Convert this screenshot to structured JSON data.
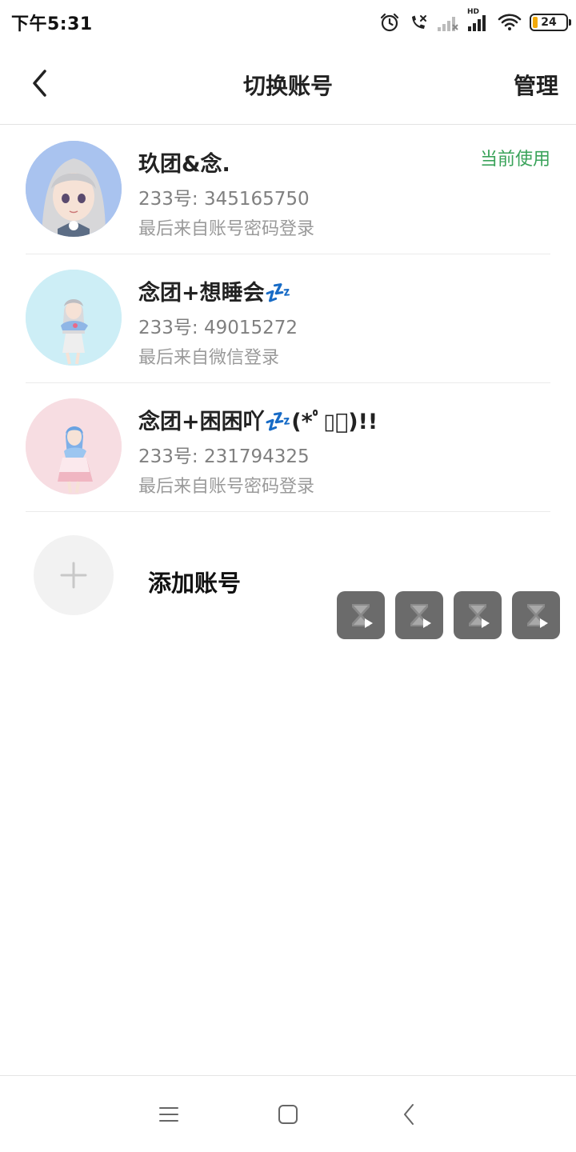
{
  "status_bar": {
    "time": "下午5:31",
    "network_label": "HD",
    "battery_level": "24",
    "icons": [
      "alarm-icon",
      "call-muted-icon",
      "signal-weak-icon",
      "signal-hd-icon",
      "wifi-icon",
      "battery-icon"
    ]
  },
  "header": {
    "title": "切换账号",
    "manage_label": "管理",
    "back_icon": "chevron-left-icon"
  },
  "accounts": [
    {
      "name": "玖团&念.",
      "id_text": "233号: 345165750",
      "login_text": "最后来自账号密码登录",
      "badge": "当前使用",
      "avatar_bg": "#a9c3ef"
    },
    {
      "name": "念团+想睡会💤",
      "id_text": "233号: 49015272",
      "login_text": "最后来自微信登录",
      "badge": "",
      "avatar_bg": "#cdeef6"
    },
    {
      "name": "念团+困困吖💤(*ﾟ▯ﾟ)!!",
      "id_text": "233号: 231794325",
      "login_text": "最后来自账号密码登录",
      "badge": "",
      "avatar_bg": "#f7dde2"
    }
  ],
  "add_account": {
    "label": "添加账号",
    "icon": "plus-icon"
  },
  "tool_buttons": [
    "hourglass-play-icon",
    "hourglass-play-icon",
    "hourglass-play-icon",
    "hourglass-play-icon"
  ],
  "colors": {
    "current_badge": "#3aa35a",
    "tool_button_bg": "#6b6b6b",
    "add_circle_bg": "#f2f2f2"
  },
  "nav_bar": {
    "icons": [
      "menu-icon",
      "home-square-icon",
      "back-arrow-icon"
    ]
  }
}
